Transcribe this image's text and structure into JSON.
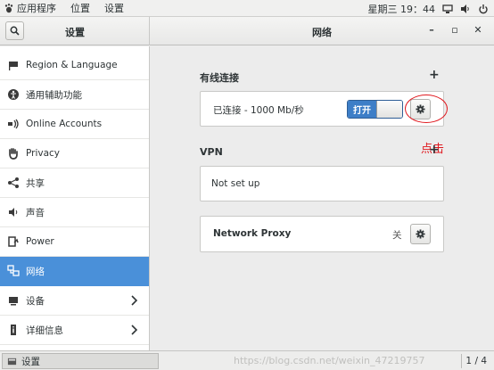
{
  "topbar": {
    "apps_label": "应用程序",
    "places_label": "位置",
    "settings_label": "设置",
    "clock": "星期三 19：44"
  },
  "header": {
    "left_title": "设置",
    "right_title": "网络",
    "minimize": "–",
    "maximize": "▫",
    "close": "✕"
  },
  "sidebar": {
    "items": [
      {
        "label": "Region & Language",
        "icon": "flag-icon"
      },
      {
        "label": "通用辅助功能",
        "icon": "accessibility-icon"
      },
      {
        "label": "Online Accounts",
        "icon": "online-accounts-icon"
      },
      {
        "label": "Privacy",
        "icon": "privacy-hand-icon"
      },
      {
        "label": "共享",
        "icon": "share-icon"
      },
      {
        "label": "声音",
        "icon": "speaker-icon"
      },
      {
        "label": "Power",
        "icon": "power-icon"
      },
      {
        "label": "网络",
        "icon": "network-icon",
        "active": true
      },
      {
        "label": "设备",
        "icon": "devices-icon",
        "has_arrow": true
      },
      {
        "label": "详细信息",
        "icon": "info-icon",
        "has_arrow": true
      }
    ]
  },
  "main": {
    "wired": {
      "title": "有线连接",
      "add": "+",
      "status": "已连接 - 1000 Mb/秒",
      "switch_label": "打开"
    },
    "vpn": {
      "title": "VPN",
      "add": "+",
      "status": "Not set up"
    },
    "proxy": {
      "label": "Network Proxy",
      "state": "关"
    },
    "annotation": "点击"
  },
  "bottombar": {
    "task_label": "设置",
    "watermark": "https://blog.csdn.net/weixin_47219757",
    "pager": "1 / 4"
  },
  "colors": {
    "accent": "#4a90d9",
    "switch_on": "#3d7ec7",
    "annotation": "#e0191f"
  }
}
